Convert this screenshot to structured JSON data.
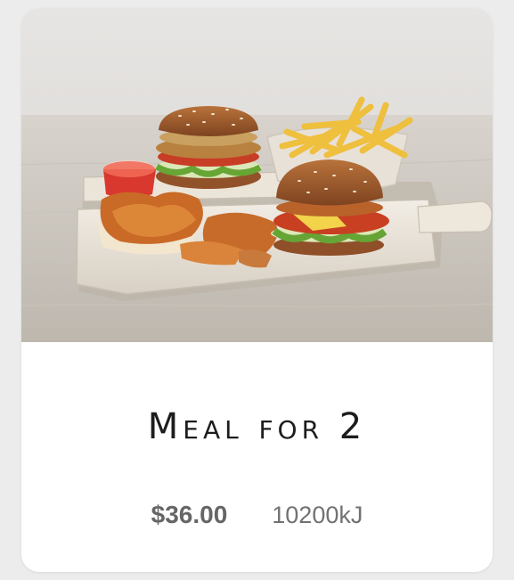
{
  "card": {
    "image_alt": "Meal for 2 food photo",
    "title": "Meal for 2",
    "price": "$36.00",
    "energy": "10200kJ"
  },
  "colors": {
    "background": "#ececec",
    "card": "#ffffff",
    "title": "#1d1d1d",
    "price": "#666666",
    "energy": "#727272"
  }
}
